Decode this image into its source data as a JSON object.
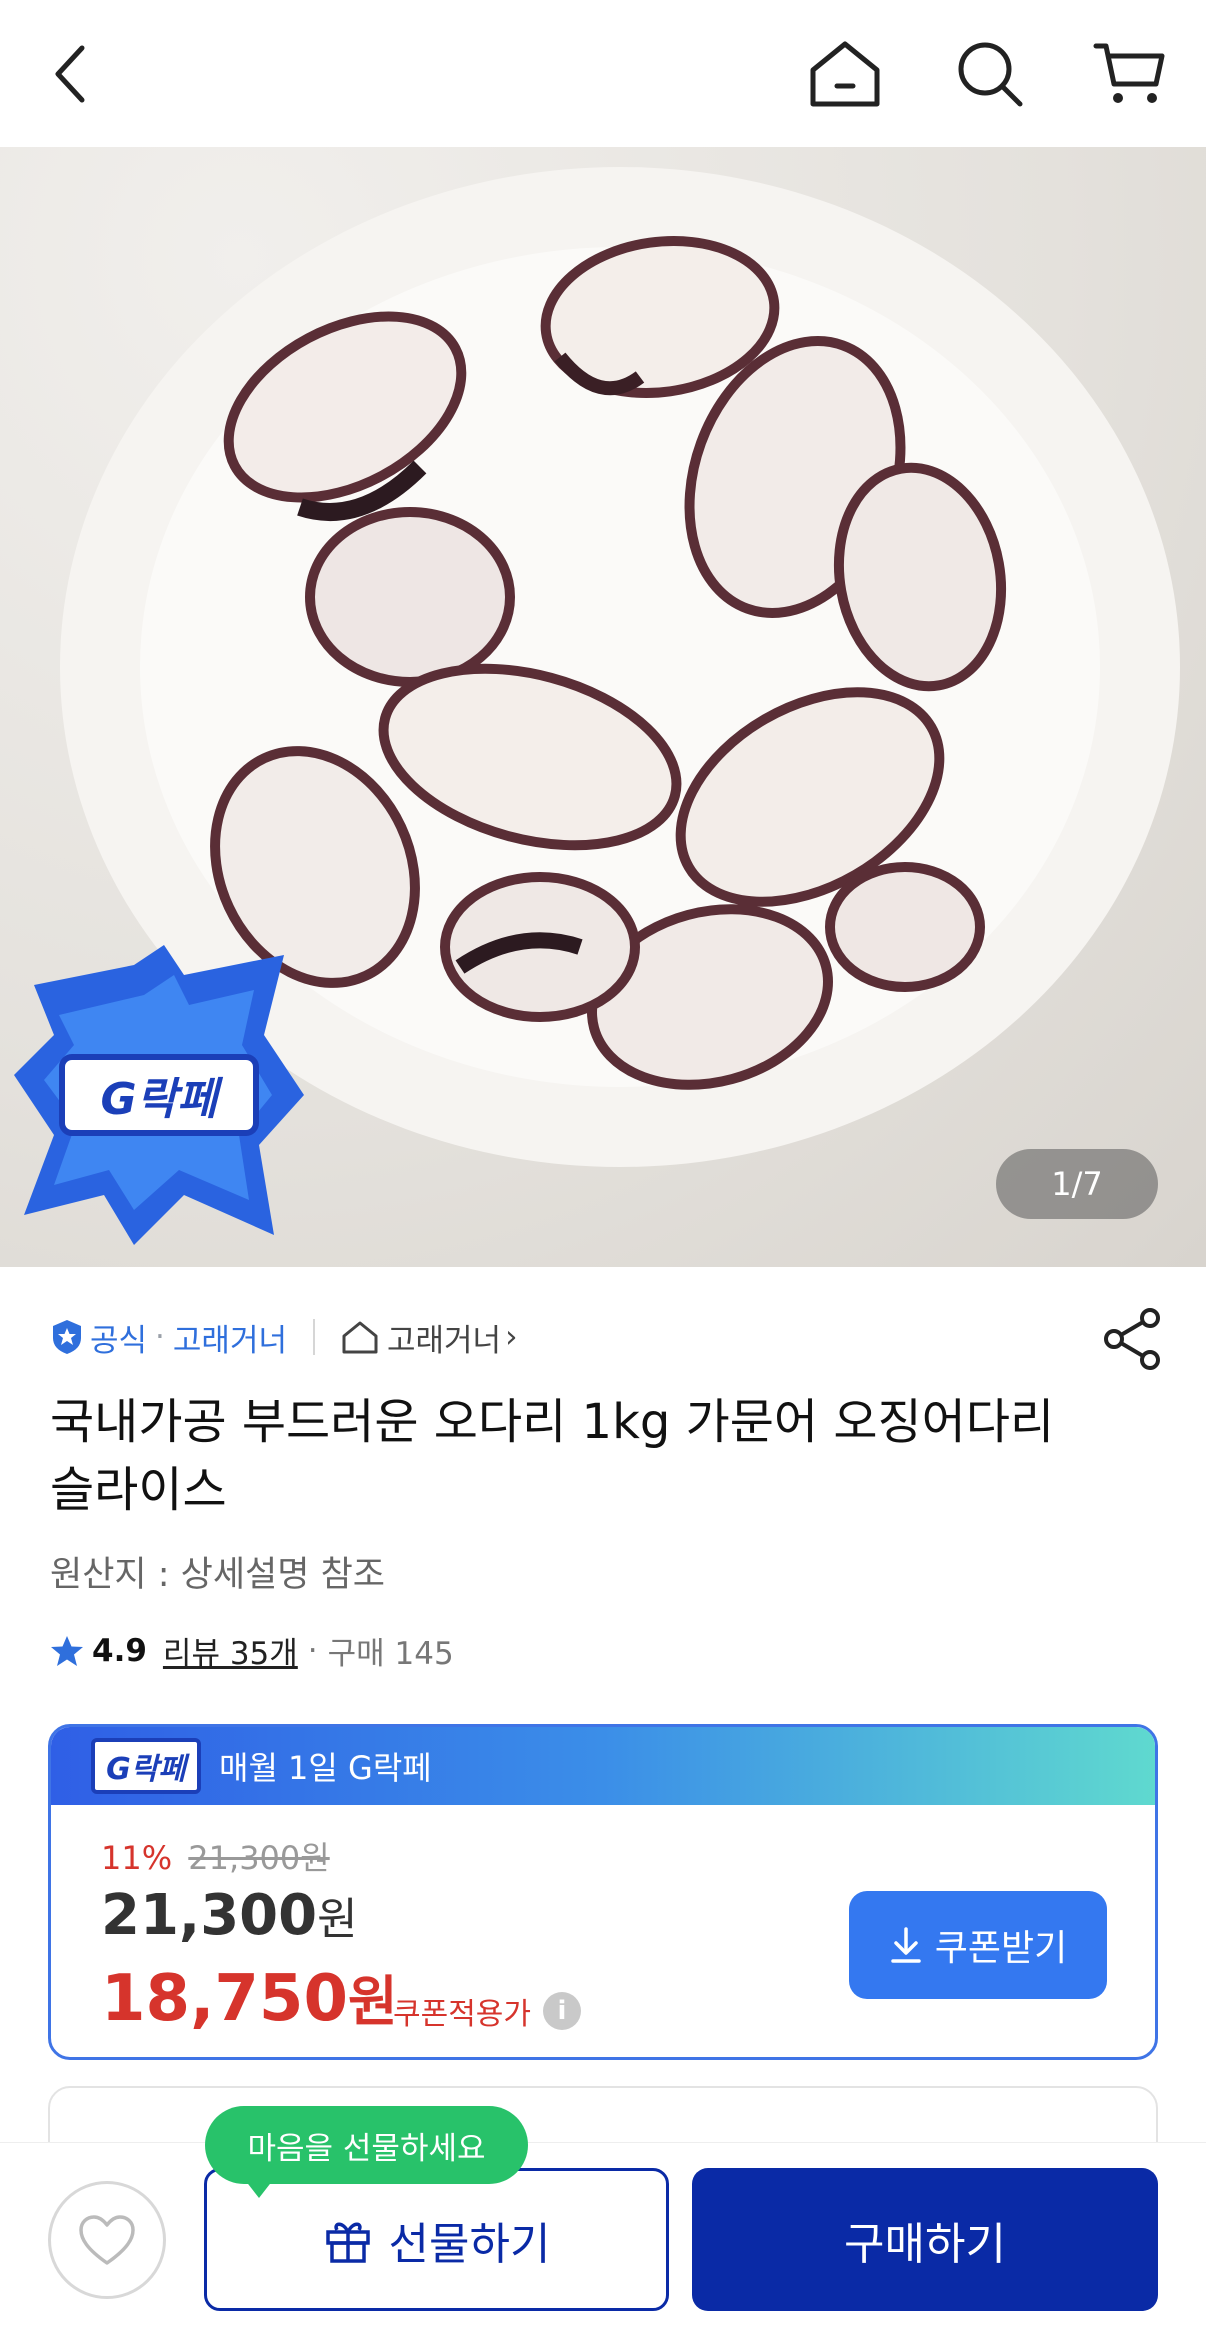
{
  "topbar": {
    "back_icon": "chevron-left-icon",
    "home_icon": "home-icon",
    "search_icon": "search-icon",
    "cart_icon": "cart-icon"
  },
  "hero": {
    "counter": "1/7",
    "badge_text": "G락페"
  },
  "seller": {
    "official_label": "공식",
    "brand": "고래거너",
    "shop_name": "고래거너",
    "shop_arrow": "›"
  },
  "product": {
    "title": "국내가공 부드러운 오다리 1kg 가문어 오징어다리 슬라이스",
    "origin": "원산지 : 상세설명 참조",
    "rating": "4.9",
    "reviews": "리뷰 35개",
    "purchases": "구매 145"
  },
  "promo": {
    "badge": "G락페",
    "banner": "매월 1일 G락페",
    "discount_pct": "11%",
    "original_price": "21,300원",
    "price_number": "21,300",
    "price_unit": "원",
    "sale_number": "18,750",
    "sale_unit": "원",
    "coupon_note": "쿠폰적용가",
    "coupon_button": "쿠폰받기"
  },
  "bottom": {
    "tooltip": "마음을 선물하세요",
    "gift_button": "선물하기",
    "buy_button": "구매하기"
  },
  "colors": {
    "accent": "#3478f0",
    "navy": "#0a2aa6",
    "sale": "#d6342c",
    "tooltip": "#28c26a"
  }
}
